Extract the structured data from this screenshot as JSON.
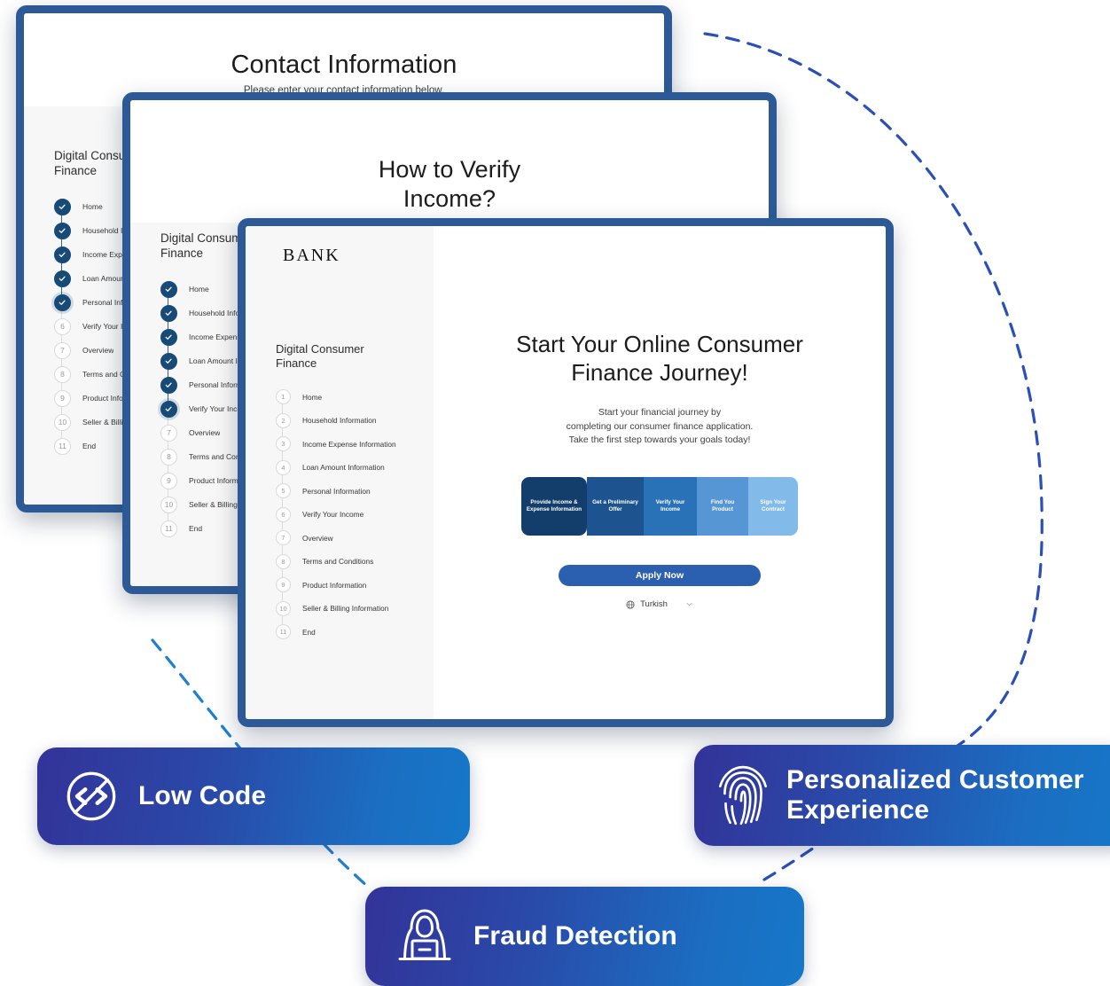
{
  "theme": {
    "frame_blue": "#2d5a96",
    "accent_blue": "#2b5fb0",
    "step_done": "#174a77",
    "arc_dark": "#2b4fb8",
    "arc_light": "#1d7fd4",
    "pill_gradient_start": "#333399",
    "pill_gradient_end": "#1677c8"
  },
  "cards": {
    "back": {
      "title": "Contact Information",
      "subtitle": "Please enter your contact information below.",
      "nav_title": "Digital Consumer Finance",
      "completed_count": 5,
      "glow_index": 4,
      "steps": [
        "Home",
        "Household Information",
        "Income Expense Information",
        "Loan Amount Information",
        "Personal Information",
        "Verify Your Income",
        "Overview",
        "Terms and Conditions",
        "Product Information",
        "Seller & Billing Information",
        "End"
      ]
    },
    "middle": {
      "title": "How to Verify Income?",
      "nav_title": "Digital Consumer Finance",
      "completed_count": 6,
      "glow_index": 5,
      "steps": [
        "Home",
        "Household Information",
        "Income Expense Information",
        "Loan Amount Information",
        "Personal Information",
        "Verify Your Income",
        "Overview",
        "Terms and Conditions",
        "Product Information",
        "Seller & Billing Information",
        "End"
      ]
    },
    "front": {
      "brand": "BANK",
      "nav_title": "Digital Consumer Finance",
      "completed_count": 0,
      "steps": [
        "Home",
        "Household Information",
        "Income Expense Information",
        "Loan Amount Information",
        "Personal Information",
        "Verify Your Income",
        "Overview",
        "Terms and Conditions",
        "Product Information",
        "Seller & Billing Information",
        "End"
      ],
      "hero": {
        "heading": "Start Your Online Consumer Finance Journey!",
        "lede_lines": [
          "Start your financial journey by",
          "completing our consumer finance application.",
          "Take the first step towards your goals today!"
        ],
        "chips": [
          {
            "label": "Provide Income & Expense Information",
            "color": "#133d6b"
          },
          {
            "label": "Get a Preliminary Offer",
            "color": "#1d5490"
          },
          {
            "label": "Verify Your Income",
            "color": "#2a72b8"
          },
          {
            "label": "Find You Product",
            "color": "#5796d4"
          },
          {
            "label": "Sign Your Contract",
            "color": "#82bbea"
          }
        ],
        "apply_label": "Apply Now",
        "language": "Turkish"
      }
    }
  },
  "features": [
    {
      "id": "low-code",
      "label": "Low Code",
      "icon": "low-code-icon"
    },
    {
      "id": "personalized-customer-experience",
      "label": "Personalized Customer Experience",
      "icon": "fingerprint-icon"
    },
    {
      "id": "fraud-detection",
      "label": "Fraud Detection",
      "icon": "hacker-laptop-icon"
    }
  ]
}
